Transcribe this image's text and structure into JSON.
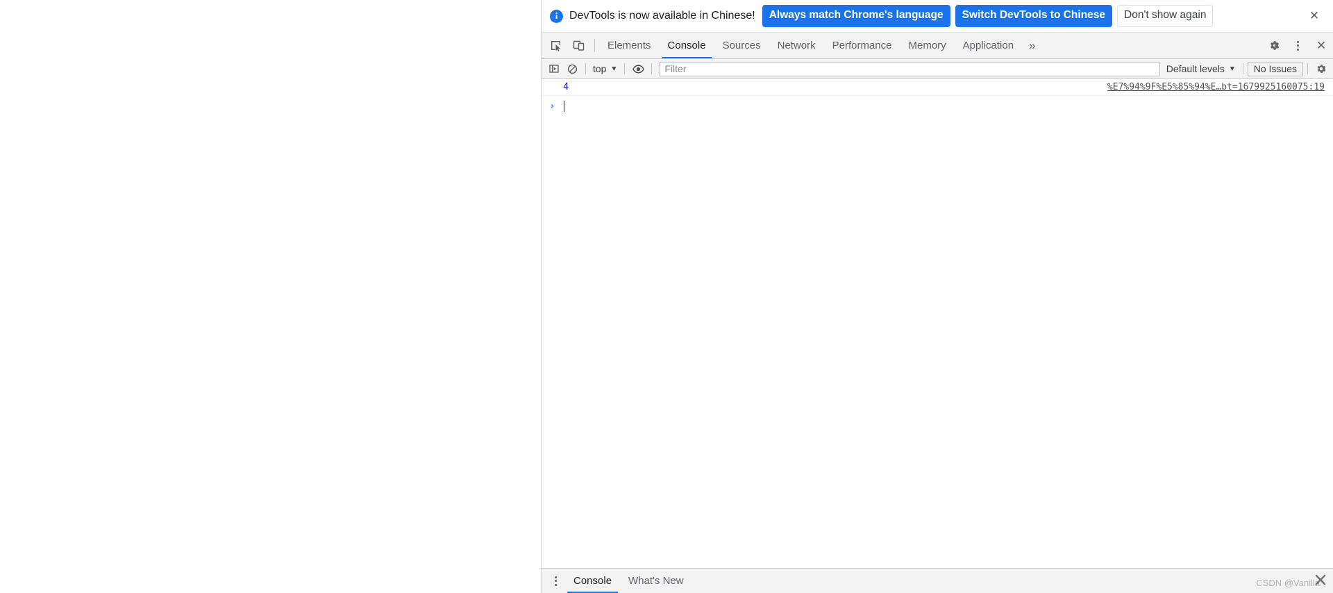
{
  "banner": {
    "icon": "info-icon",
    "message": "DevTools is now available in Chinese!",
    "primary_button": "Always match Chrome's language",
    "secondary_button": "Switch DevTools to Chinese",
    "dismiss_button": "Don't show again",
    "close_icon": "✕",
    "accent_color": "#1a73e8"
  },
  "tabbar": {
    "inspect_icon": "inspect-element-icon",
    "device_icon": "device-toolbar-icon",
    "tabs": [
      {
        "label": "Elements",
        "active": false
      },
      {
        "label": "Console",
        "active": true
      },
      {
        "label": "Sources",
        "active": false
      },
      {
        "label": "Network",
        "active": false
      },
      {
        "label": "Performance",
        "active": false
      },
      {
        "label": "Memory",
        "active": false
      },
      {
        "label": "Application",
        "active": false
      }
    ],
    "more_tabs_icon": "»",
    "settings_icon": "gear-icon",
    "menu_icon": "kebab-menu-icon",
    "close_icon": "✕",
    "active_underline_color": "#1a73e8"
  },
  "console_toolbar": {
    "sidebar_icon": "console-sidebar-icon",
    "clear_icon": "clear-console-icon",
    "context_selector": "top",
    "context_caret": "▼",
    "eye_icon": "live-expression-icon",
    "filter_placeholder": "Filter",
    "filter_value": "",
    "levels_label": "Default levels",
    "levels_caret": "▼",
    "issues_label": "No Issues",
    "settings_icon": "gear-icon"
  },
  "console": {
    "rows": [
      {
        "value": "4",
        "value_color": "#1a1aa6",
        "source_link": "%E7%94%9F%E5%85%94%E…bt=1679925160075:19"
      }
    ],
    "prompt_arrow": "›",
    "prompt_value": ""
  },
  "drawer": {
    "kebab_icon": "kebab-menu-icon",
    "tabs": [
      {
        "label": "Console",
        "active": true
      },
      {
        "label": "What's New",
        "active": false
      }
    ]
  },
  "watermark": {
    "text": "CSDN @Vanilla",
    "logo": "csdn-x-logo"
  }
}
